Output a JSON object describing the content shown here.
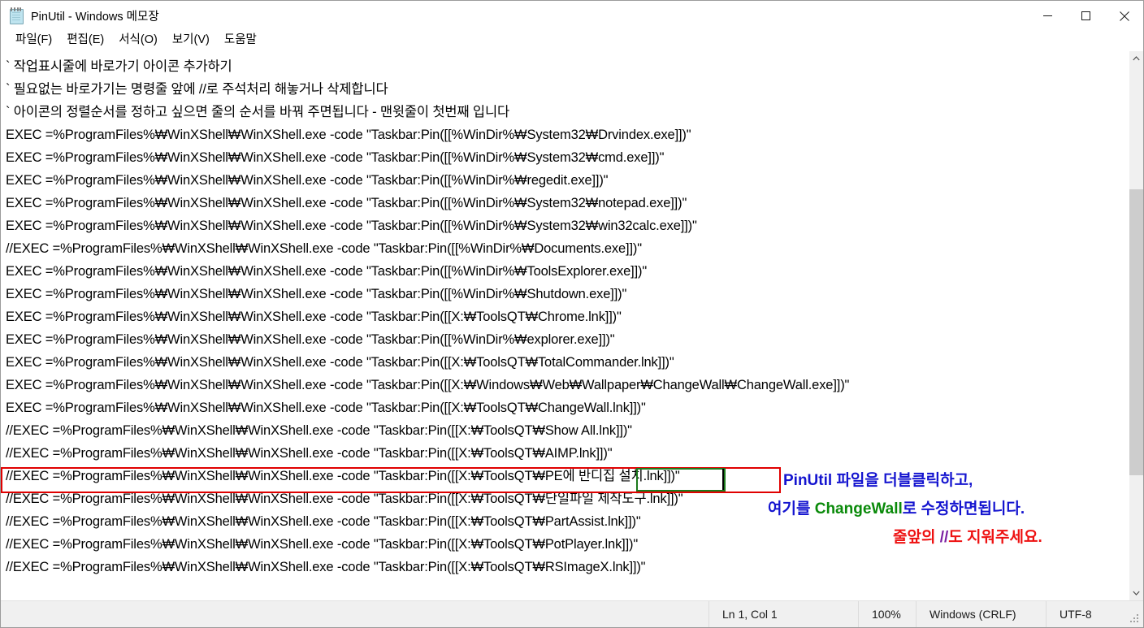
{
  "window": {
    "title": "PinUtil - Windows 메모장",
    "icon": "notepad-icon",
    "caption": {
      "minimize": "minimize-icon",
      "maximize": "maximize-icon",
      "close": "close-icon"
    }
  },
  "menubar": {
    "items": [
      {
        "label": "파일(F)",
        "name": "menu-file"
      },
      {
        "label": "편집(E)",
        "name": "menu-edit"
      },
      {
        "label": "서식(O)",
        "name": "menu-format"
      },
      {
        "label": "보기(V)",
        "name": "menu-view"
      },
      {
        "label": "도움말",
        "name": "menu-help"
      }
    ]
  },
  "editor": {
    "lines": [
      "` 작업표시줄에 바로가기 아이콘 추가하기",
      "` 필요없는 바로가기는 명령줄 앞에 //로 주석처리 해놓거나 삭제합니다",
      "` 아이콘의 정렬순서를 정하고 싶으면 줄의 순서를 바꿔 주면됩니다 - 맨윗줄이 첫번째 입니다",
      "EXEC =%ProgramFiles%₩WinXShell₩WinXShell.exe -code \"Taskbar:Pin([[%WinDir%₩System32₩Drvindex.exe]])\"",
      "EXEC =%ProgramFiles%₩WinXShell₩WinXShell.exe -code \"Taskbar:Pin([[%WinDir%₩System32₩cmd.exe]])\"",
      "EXEC =%ProgramFiles%₩WinXShell₩WinXShell.exe -code \"Taskbar:Pin([[%WinDir%₩regedit.exe]])\"",
      "EXEC =%ProgramFiles%₩WinXShell₩WinXShell.exe -code \"Taskbar:Pin([[%WinDir%₩System32₩notepad.exe]])\"",
      "EXEC =%ProgramFiles%₩WinXShell₩WinXShell.exe -code \"Taskbar:Pin([[%WinDir%₩System32₩win32calc.exe]])\"",
      "//EXEC =%ProgramFiles%₩WinXShell₩WinXShell.exe -code \"Taskbar:Pin([[%WinDir%₩Documents.exe]])\"",
      "EXEC =%ProgramFiles%₩WinXShell₩WinXShell.exe -code \"Taskbar:Pin([[%WinDir%₩ToolsExplorer.exe]])\"",
      "EXEC =%ProgramFiles%₩WinXShell₩WinXShell.exe -code \"Taskbar:Pin([[%WinDir%₩Shutdown.exe]])\"",
      "EXEC =%ProgramFiles%₩WinXShell₩WinXShell.exe -code \"Taskbar:Pin([[X:₩ToolsQT₩Chrome.lnk]])\"",
      "EXEC =%ProgramFiles%₩WinXShell₩WinXShell.exe -code \"Taskbar:Pin([[%WinDir%₩explorer.exe]])\"",
      "EXEC =%ProgramFiles%₩WinXShell₩WinXShell.exe -code \"Taskbar:Pin([[X:₩ToolsQT₩TotalCommander.lnk]])\"",
      "EXEC =%ProgramFiles%₩WinXShell₩WinXShell.exe -code \"Taskbar:Pin([[X:₩Windows₩Web₩Wallpaper₩ChangeWall₩ChangeWall.exe]])\"",
      "EXEC =%ProgramFiles%₩WinXShell₩WinXShell.exe -code \"Taskbar:Pin([[X:₩ToolsQT₩ChangeWall.lnk]])\"",
      "//EXEC =%ProgramFiles%₩WinXShell₩WinXShell.exe -code \"Taskbar:Pin([[X:₩ToolsQT₩Show All.lnk]])\"",
      "//EXEC =%ProgramFiles%₩WinXShell₩WinXShell.exe -code \"Taskbar:Pin([[X:₩ToolsQT₩AIMP.lnk]])\"",
      "//EXEC =%ProgramFiles%₩WinXShell₩WinXShell.exe -code \"Taskbar:Pin([[X:₩ToolsQT₩PE에 반디집 설치.lnk]])\"",
      "//EXEC =%ProgramFiles%₩WinXShell₩WinXShell.exe -code \"Taskbar:Pin([[X:₩ToolsQT₩단일파일 제작도구.lnk]])\"",
      "//EXEC =%ProgramFiles%₩WinXShell₩WinXShell.exe -code \"Taskbar:Pin([[X:₩ToolsQT₩PartAssist.lnk]])\"",
      "//EXEC =%ProgramFiles%₩WinXShell₩WinXShell.exe -code \"Taskbar:Pin([[X:₩ToolsQT₩PotPlayer.lnk]])\"",
      "//EXEC =%ProgramFiles%₩WinXShell₩WinXShell.exe -code \"Taskbar:Pin([[X:₩ToolsQT₩RSImageX.lnk]])\""
    ],
    "highlight": {
      "red_box_line_index": 15,
      "green_box_text": "ChangeWall",
      "red_color": "#e00000",
      "green_color": "#1c7a1c"
    }
  },
  "annotations": [
    {
      "name": "annotation-line-1",
      "parts": [
        {
          "text": "PinUtil",
          "color": "#1414cf"
        },
        {
          "text": " 파일을 더블클릭하고,",
          "color": "#1414cf"
        }
      ]
    },
    {
      "name": "annotation-line-2",
      "parts": [
        {
          "text": "여기를 ",
          "color": "#1414cf"
        },
        {
          "text": "ChangeWall",
          "color": "#0a8a0a"
        },
        {
          "text": "로 수정하면됩니다.",
          "color": "#1414cf"
        }
      ]
    },
    {
      "name": "annotation-line-3",
      "parts": [
        {
          "text": "줄앞의 ",
          "color": "#ee1111"
        },
        {
          "text": "//",
          "color": "#7b1fa2"
        },
        {
          "text": "도 지워주세요.",
          "color": "#ee1111"
        }
      ]
    }
  ],
  "statusbar": {
    "position": "Ln 1, Col 1",
    "zoom": "100%",
    "line_ending": "Windows (CRLF)",
    "encoding": "UTF-8"
  },
  "scrollbar": {
    "up_arrow": "chevron-up-icon",
    "down_arrow": "chevron-down-icon"
  }
}
